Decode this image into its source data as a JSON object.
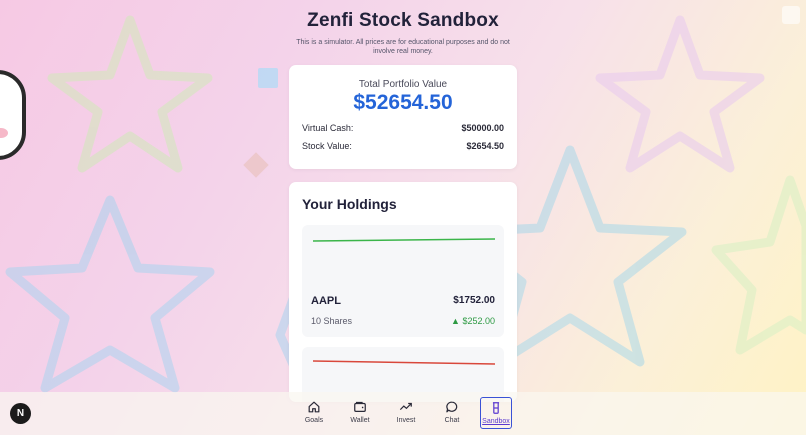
{
  "header": {
    "title": "Zenfi Stock Sandbox",
    "subtitle": "This is a simulator. All prices are for educational purposes and do not involve real money."
  },
  "portfolio": {
    "total_label": "Total Portfolio Value",
    "total_value": "$52654.50",
    "cash_label": "Virtual Cash:",
    "cash_value": "$50000.00",
    "stock_label": "Stock Value:",
    "stock_value": "$2654.50"
  },
  "holdings": {
    "title": "Your Holdings",
    "items": [
      {
        "symbol": "AAPL",
        "value": "$1752.00",
        "shares": "10 Shares",
        "change": "▲ $252.00",
        "trend_color": "#3bb54a"
      },
      {
        "trend_color": "#d9483b"
      }
    ]
  },
  "nav": {
    "badge": "N",
    "items": [
      {
        "label": "Goals",
        "icon": "home-icon"
      },
      {
        "label": "Wallet",
        "icon": "wallet-icon"
      },
      {
        "label": "Invest",
        "icon": "trend-icon"
      },
      {
        "label": "Chat",
        "icon": "chat-bubble-icon"
      },
      {
        "label": "Sandbox",
        "icon": "beaker-icon",
        "active": true
      }
    ]
  },
  "colors": {
    "accent_blue": "#2464d8",
    "positive_green": "#2d9a43",
    "negative_red": "#d9483b",
    "active_nav": "#3a52d6"
  }
}
